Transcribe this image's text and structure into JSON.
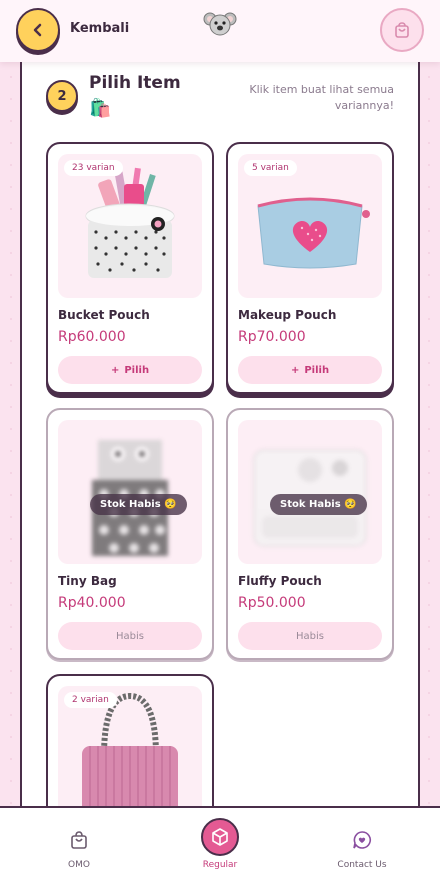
{
  "header": {
    "back_label": "Kembali",
    "logo_icon": "koala-icon",
    "cart_icon": "shopping-bag-icon"
  },
  "section": {
    "step": "2",
    "title": "Pilih Item",
    "emoji": "🛍️",
    "hint": "Klik item buat lihat semua variannya!"
  },
  "products": [
    {
      "name": "Bucket Pouch",
      "price": "Rp60.000",
      "variants": "23 varian",
      "button": "Pilih",
      "available": true
    },
    {
      "name": "Makeup Pouch",
      "price": "Rp70.000",
      "variants": "5 varian",
      "button": "Pilih",
      "available": true
    },
    {
      "name": "Tiny Bag",
      "price": "Rp40.000",
      "stock": "Stok Habis 🥺",
      "button": "Habis",
      "available": false
    },
    {
      "name": "Fluffy Pouch",
      "price": "Rp50.000",
      "stock": "Stok Habis 🥺",
      "button": "Habis",
      "available": false
    },
    {
      "name": "",
      "price": "",
      "variants": "2 varian",
      "button": "",
      "available": true
    }
  ],
  "nav": [
    {
      "label": "OMO",
      "icon": "bag-icon"
    },
    {
      "label": "Regular",
      "icon": "cube-icon",
      "active": true
    },
    {
      "label": "Contact Us",
      "icon": "chat-heart-icon"
    }
  ],
  "colors": {
    "accent": "#c53b7a",
    "yellow": "#ffd15c",
    "outline": "#4a2e4a",
    "pink_soft": "#fde0ec"
  }
}
